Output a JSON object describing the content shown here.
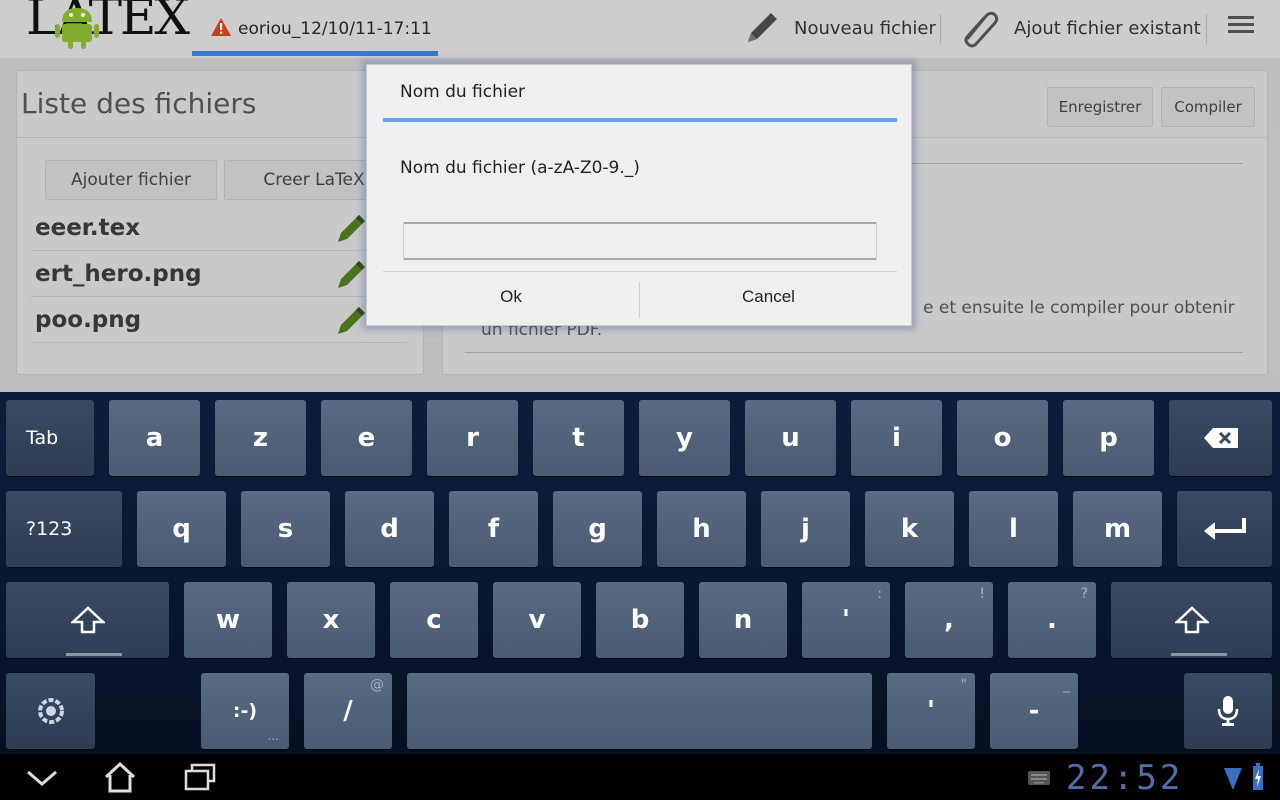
{
  "actionbar": {
    "logo_text": "LATEX",
    "doc_tab_label": "eoriou_12/10/11-17:11",
    "new_file_label": "Nouveau fichier",
    "attach_file_label": "Ajout fichier existant"
  },
  "left_panel": {
    "title": "Liste des fichiers",
    "add_file_label": "Ajouter fichier",
    "create_latex_label": "Creer LaTeX",
    "files": [
      "eeer.tex",
      "ert_hero.png",
      "poo.png"
    ]
  },
  "right_panel": {
    "save_label": "Enregistrer",
    "compile_label": "Compiler",
    "body_text_line1": "e et ensuite le compiler pour obtenir",
    "body_text_line2": "un fichier PDF."
  },
  "dialog": {
    "title": "Nom du fichier",
    "message": "Nom du fichier (a-zA-Z0-9._)",
    "input_value": "",
    "ok_label": "Ok",
    "cancel_label": "Cancel"
  },
  "keyboard": {
    "row1": [
      "Tab",
      "a",
      "z",
      "e",
      "r",
      "t",
      "y",
      "u",
      "i",
      "o",
      "p"
    ],
    "row2": [
      "?123",
      "q",
      "s",
      "d",
      "f",
      "g",
      "h",
      "j",
      "k",
      "l",
      "m"
    ],
    "row3": [
      "w",
      "x",
      "c",
      "v",
      "b",
      "n",
      "'",
      "，",
      ".",
      ":",
      "!",
      "?"
    ],
    "row3_letters": [
      "w",
      "x",
      "c",
      "v",
      "b",
      "n"
    ],
    "row3_punct": [
      "'",
      ",",
      "."
    ],
    "row3_punct_hints": [
      ":",
      "!",
      "?"
    ],
    "row4_smiley": ":-)",
    "row4_slash": "/",
    "row4_slash_hint": "@",
    "row4_apos": "'",
    "row4_apos_hint": "\"",
    "row4_dash": "-",
    "row4_dash_hint": "_",
    "row4_dots": "..."
  },
  "sysbar": {
    "clock": "22:52"
  },
  "colors": {
    "accent": "#3c7fd8",
    "dialog_accent": "#6b9ee8",
    "keyboard_bg": "#0c1d3c",
    "clock": "#4f6fa8"
  }
}
